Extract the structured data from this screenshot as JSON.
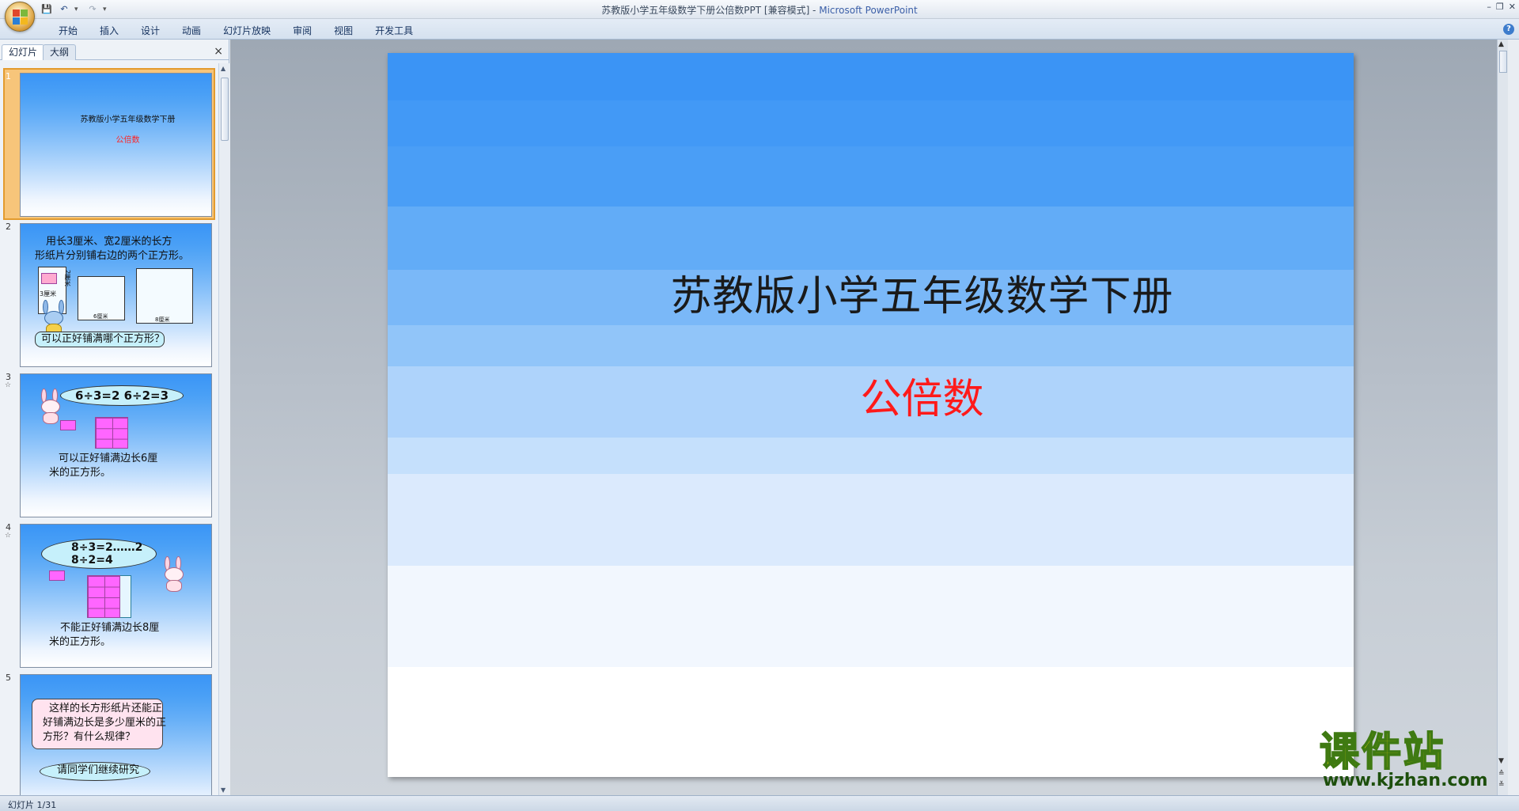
{
  "window": {
    "title": "苏教版小学五年级数学下册公倍数PPT [兼容模式] - ",
    "app_name": "Microsoft PowerPoint"
  },
  "ribbon": {
    "tabs": [
      "开始",
      "插入",
      "设计",
      "动画",
      "幻灯片放映",
      "审阅",
      "视图",
      "开发工具"
    ]
  },
  "panel": {
    "tab_slides": "幻灯片",
    "tab_outline": "大纲",
    "close": "×"
  },
  "thumbnails": [
    {
      "number": "1",
      "title": "苏教版小学五年级数学下册",
      "subtitle": "公倍数"
    },
    {
      "number": "2",
      "line1": "用长3厘米、宽2厘米的长方",
      "line2": "形纸片分别铺右边的两个正方形。",
      "question": "可以正好铺满哪个正方形？",
      "label_3cm": "3厘米",
      "label_2cm": "2厘米",
      "label_6cm": "6厘米",
      "label_8cm": "8厘米"
    },
    {
      "number": "3",
      "equation": "6÷3=2   6÷2=3",
      "line1": "可以正好铺满边长6厘",
      "line2": "米的正方形。"
    },
    {
      "number": "4",
      "equation1": "8÷3=2……2",
      "equation2": "8÷2=4",
      "line1": "不能正好铺满边长8厘",
      "line2": "米的正方形。"
    },
    {
      "number": "5",
      "line1": "这样的长方形纸片还能正",
      "line2": "好铺满边长是多少厘米的正",
      "line3": "方形？有什么规律？",
      "line4": "请同学们继续研究"
    }
  ],
  "slide": {
    "title": "苏教版小学五年级数学下册",
    "subtitle": "公倍数",
    "subtitle_color": "#ff1a1a"
  },
  "status": {
    "slide_counter": "幻灯片 1/31"
  },
  "watermark": {
    "main": "课件站",
    "url": "www.kjzhan.com"
  }
}
